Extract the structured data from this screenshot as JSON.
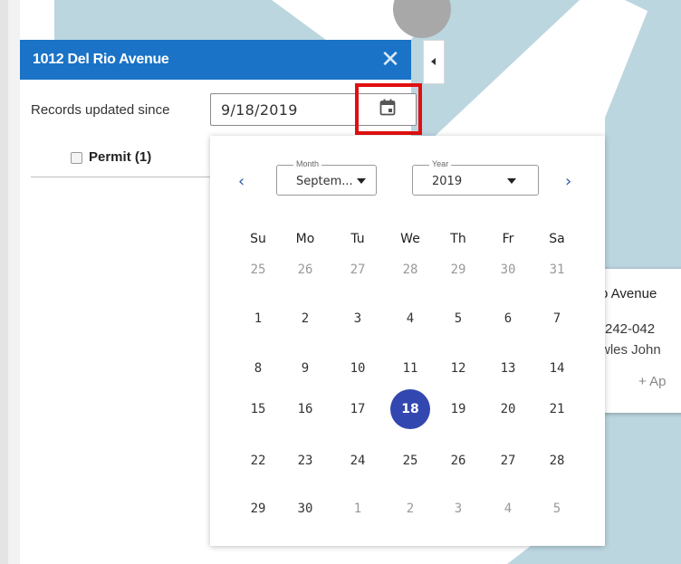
{
  "panel": {
    "title": "1012 Del Rio Avenue",
    "close_label": "✕",
    "since_label": "Records updated since",
    "date_value": "9/18/2019",
    "permit_label": "Permit (1)"
  },
  "info_card": {
    "title": "o Avenue",
    "line1": "-242-042",
    "line2": "wles John",
    "add_label": "+ Ap"
  },
  "calendar": {
    "prev_icon": "chevron-left",
    "next_icon": "chevron-right",
    "month_legend": "Month",
    "month_value": "Septem...",
    "year_legend": "Year",
    "year_value": "2019",
    "weekdays": [
      "Su",
      "Mo",
      "Tu",
      "We",
      "Th",
      "Fr",
      "Sa"
    ],
    "weeks": [
      [
        "25",
        "26",
        "27",
        "28",
        "29",
        "30",
        "31"
      ],
      [
        "1",
        "2",
        "3",
        "4",
        "5",
        "6",
        "7"
      ],
      [
        "8",
        "9",
        "10",
        "11",
        "12",
        "13",
        "14"
      ],
      [
        "15",
        "16",
        "17",
        "18",
        "19",
        "20",
        "21"
      ],
      [
        "22",
        "23",
        "24",
        "25",
        "26",
        "27",
        "28"
      ],
      [
        "29",
        "30",
        "1",
        "2",
        "3",
        "4",
        "5"
      ]
    ],
    "selected_day": "18"
  },
  "colors": {
    "header": "#1a73c6",
    "highlight_box": "#e10f0f",
    "selected_day": "#3347b0"
  }
}
